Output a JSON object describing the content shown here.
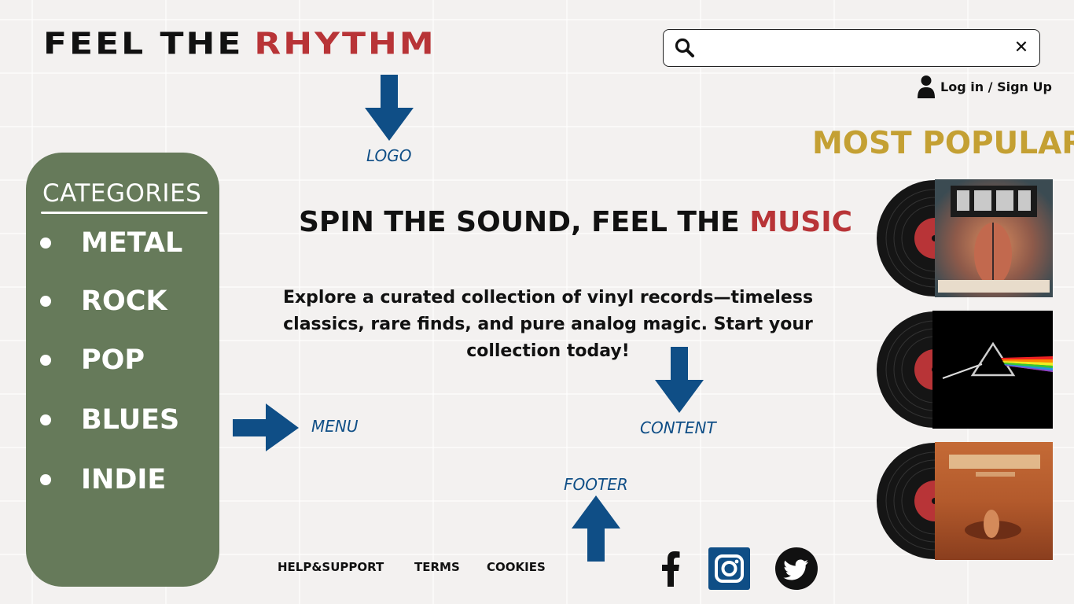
{
  "header": {
    "logo_part1": "FEEL THE",
    "logo_part2": "RHYTHM"
  },
  "search": {
    "value": "",
    "icon": "search-icon",
    "clear_icon": "close-icon",
    "clear_glyph": "✕"
  },
  "account": {
    "login_label": "Log in / Sign Up",
    "icon": "user-icon"
  },
  "annotations": {
    "logo": "LOGO",
    "menu": "MENU",
    "content": "CONTENT",
    "footer": "FOOTER"
  },
  "categories": {
    "title": "CATEGORIES",
    "items": [
      "METAL",
      "ROCK",
      "POP",
      "BLUES",
      "INDIE"
    ]
  },
  "main": {
    "headline_part1": "SPIN THE SOUND, FEEL THE",
    "headline_part2": "MUSIC",
    "tagline": "Explore a curated collection of vinyl records—timeless classics, rare finds, and pure analog magic. Start your collection today!"
  },
  "popular": {
    "title": "MOST POPULAR",
    "albums": [
      "Tool – Lateralus",
      "Pink Floyd – The Dark Side of the Moon",
      "Alice in Chains – Dirt"
    ]
  },
  "footer": {
    "links": [
      "HELP&SUPPORT",
      "TERMS",
      "COOKIES"
    ],
    "social_icons": [
      "facebook-icon",
      "instagram-icon",
      "twitter-icon"
    ]
  },
  "colors": {
    "accent_red": "#b83437",
    "sidebar_green": "#667a5a",
    "gold": "#c4a033",
    "annotation_blue": "#0f4e86"
  }
}
